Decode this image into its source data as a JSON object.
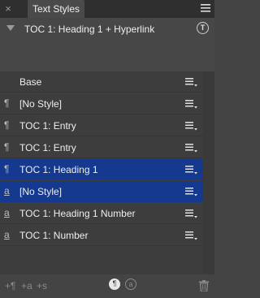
{
  "window": {
    "close_glyph": "×",
    "tab_label": "Text Styles",
    "menu_icon": "panel-menu-icon"
  },
  "preview": {
    "title": "TOC 1: Heading 1 + Hyperlink",
    "badge_letter": "T"
  },
  "styles": [
    {
      "icon": "",
      "label": "Base",
      "selected": false
    },
    {
      "icon": "¶",
      "label": "[No Style]",
      "selected": false
    },
    {
      "icon": "¶",
      "label": "TOC 1: Entry",
      "selected": false
    },
    {
      "icon": "¶",
      "label": "TOC 1: Entry",
      "selected": false
    },
    {
      "icon": "¶",
      "label": "TOC 1: Heading 1",
      "selected": true
    },
    {
      "icon": "a",
      "label": "[No Style]",
      "selected": true
    },
    {
      "icon": "a",
      "label": "TOC 1: Heading 1 Number",
      "selected": false
    },
    {
      "icon": "a",
      "label": "TOC 1: Number",
      "selected": false
    }
  ],
  "toolbar": {
    "add_paragraph": "+¶",
    "add_character": "+a",
    "add_group": "+s",
    "paragraph_toggle": "¶",
    "character_toggle": "a"
  },
  "colors": {
    "selection": "#15398f",
    "panel_bg": "#444444",
    "list_bg": "#3d3d3d"
  }
}
